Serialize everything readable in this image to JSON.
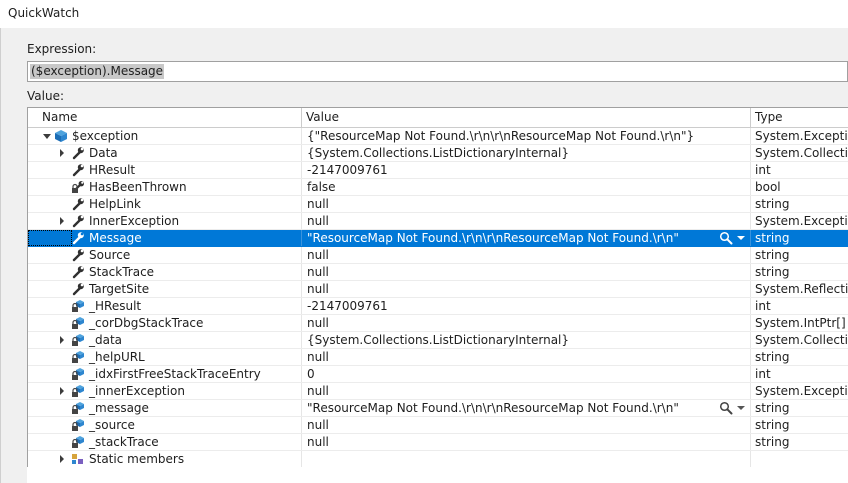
{
  "window": {
    "title": "QuickWatch"
  },
  "expression": {
    "label": "Expression:",
    "value": "($exception).Message"
  },
  "value_label": "Value:",
  "grid": {
    "columns": [
      "Name",
      "Value",
      "Type"
    ],
    "rows": [
      {
        "depth": 0,
        "expander": "expanded",
        "icon": "object-icon",
        "name": "$exception",
        "value": "{\"ResourceMap Not Found.\\r\\n\\r\\nResourceMap Not Found.\\r\\n\"}",
        "type": "System.Exception"
      },
      {
        "depth": 1,
        "expander": "collapsed",
        "icon": "property-icon",
        "name": "Data",
        "value": "{System.Collections.ListDictionaryInternal}",
        "type": "System.Collections"
      },
      {
        "depth": 1,
        "expander": "none",
        "icon": "property-icon",
        "name": "HResult",
        "value": "-2147009761",
        "type": "int"
      },
      {
        "depth": 1,
        "expander": "none",
        "icon": "property-lock-icon",
        "name": "HasBeenThrown",
        "value": "false",
        "type": "bool"
      },
      {
        "depth": 1,
        "expander": "none",
        "icon": "property-icon",
        "name": "HelpLink",
        "value": "null",
        "type": "string"
      },
      {
        "depth": 1,
        "expander": "collapsed",
        "icon": "property-icon",
        "name": "InnerException",
        "value": "null",
        "type": "System.Exception"
      },
      {
        "depth": 1,
        "expander": "none",
        "icon": "property-icon",
        "name": "Message",
        "value": "\"ResourceMap Not Found.\\r\\n\\r\\nResourceMap Not Found.\\r\\n\"",
        "type": "string",
        "selected": true,
        "visualizer": true
      },
      {
        "depth": 1,
        "expander": "none",
        "icon": "property-icon",
        "name": "Source",
        "value": "null",
        "type": "string"
      },
      {
        "depth": 1,
        "expander": "none",
        "icon": "property-icon",
        "name": "StackTrace",
        "value": "null",
        "type": "string"
      },
      {
        "depth": 1,
        "expander": "none",
        "icon": "property-icon",
        "name": "TargetSite",
        "value": "null",
        "type": "System.Reflection"
      },
      {
        "depth": 1,
        "expander": "none",
        "icon": "field-lock-icon",
        "name": "_HResult",
        "value": "-2147009761",
        "type": "int"
      },
      {
        "depth": 1,
        "expander": "none",
        "icon": "field-lock-icon",
        "name": "_corDbgStackTrace",
        "value": "null",
        "type": "System.IntPtr[]"
      },
      {
        "depth": 1,
        "expander": "collapsed",
        "icon": "field-lock-icon",
        "name": "_data",
        "value": "{System.Collections.ListDictionaryInternal}",
        "type": "System.Collection"
      },
      {
        "depth": 1,
        "expander": "none",
        "icon": "field-lock-icon",
        "name": "_helpURL",
        "value": "null",
        "type": "string"
      },
      {
        "depth": 1,
        "expander": "none",
        "icon": "field-lock-icon",
        "name": "_idxFirstFreeStackTraceEntry",
        "value": "0",
        "type": "int"
      },
      {
        "depth": 1,
        "expander": "collapsed",
        "icon": "field-lock-icon",
        "name": "_innerException",
        "value": "null",
        "type": "System.Exception"
      },
      {
        "depth": 1,
        "expander": "none",
        "icon": "field-lock-icon",
        "name": "_message",
        "value": "\"ResourceMap Not Found.\\r\\n\\r\\nResourceMap Not Found.\\r\\n\"",
        "type": "string",
        "visualizer": true
      },
      {
        "depth": 1,
        "expander": "none",
        "icon": "field-lock-icon",
        "name": "_source",
        "value": "null",
        "type": "string"
      },
      {
        "depth": 1,
        "expander": "none",
        "icon": "field-lock-icon",
        "name": "_stackTrace",
        "value": "null",
        "type": "string"
      },
      {
        "depth": 1,
        "expander": "collapsed",
        "icon": "static-members-icon",
        "name": "Static members",
        "value": "",
        "type": ""
      }
    ]
  }
}
